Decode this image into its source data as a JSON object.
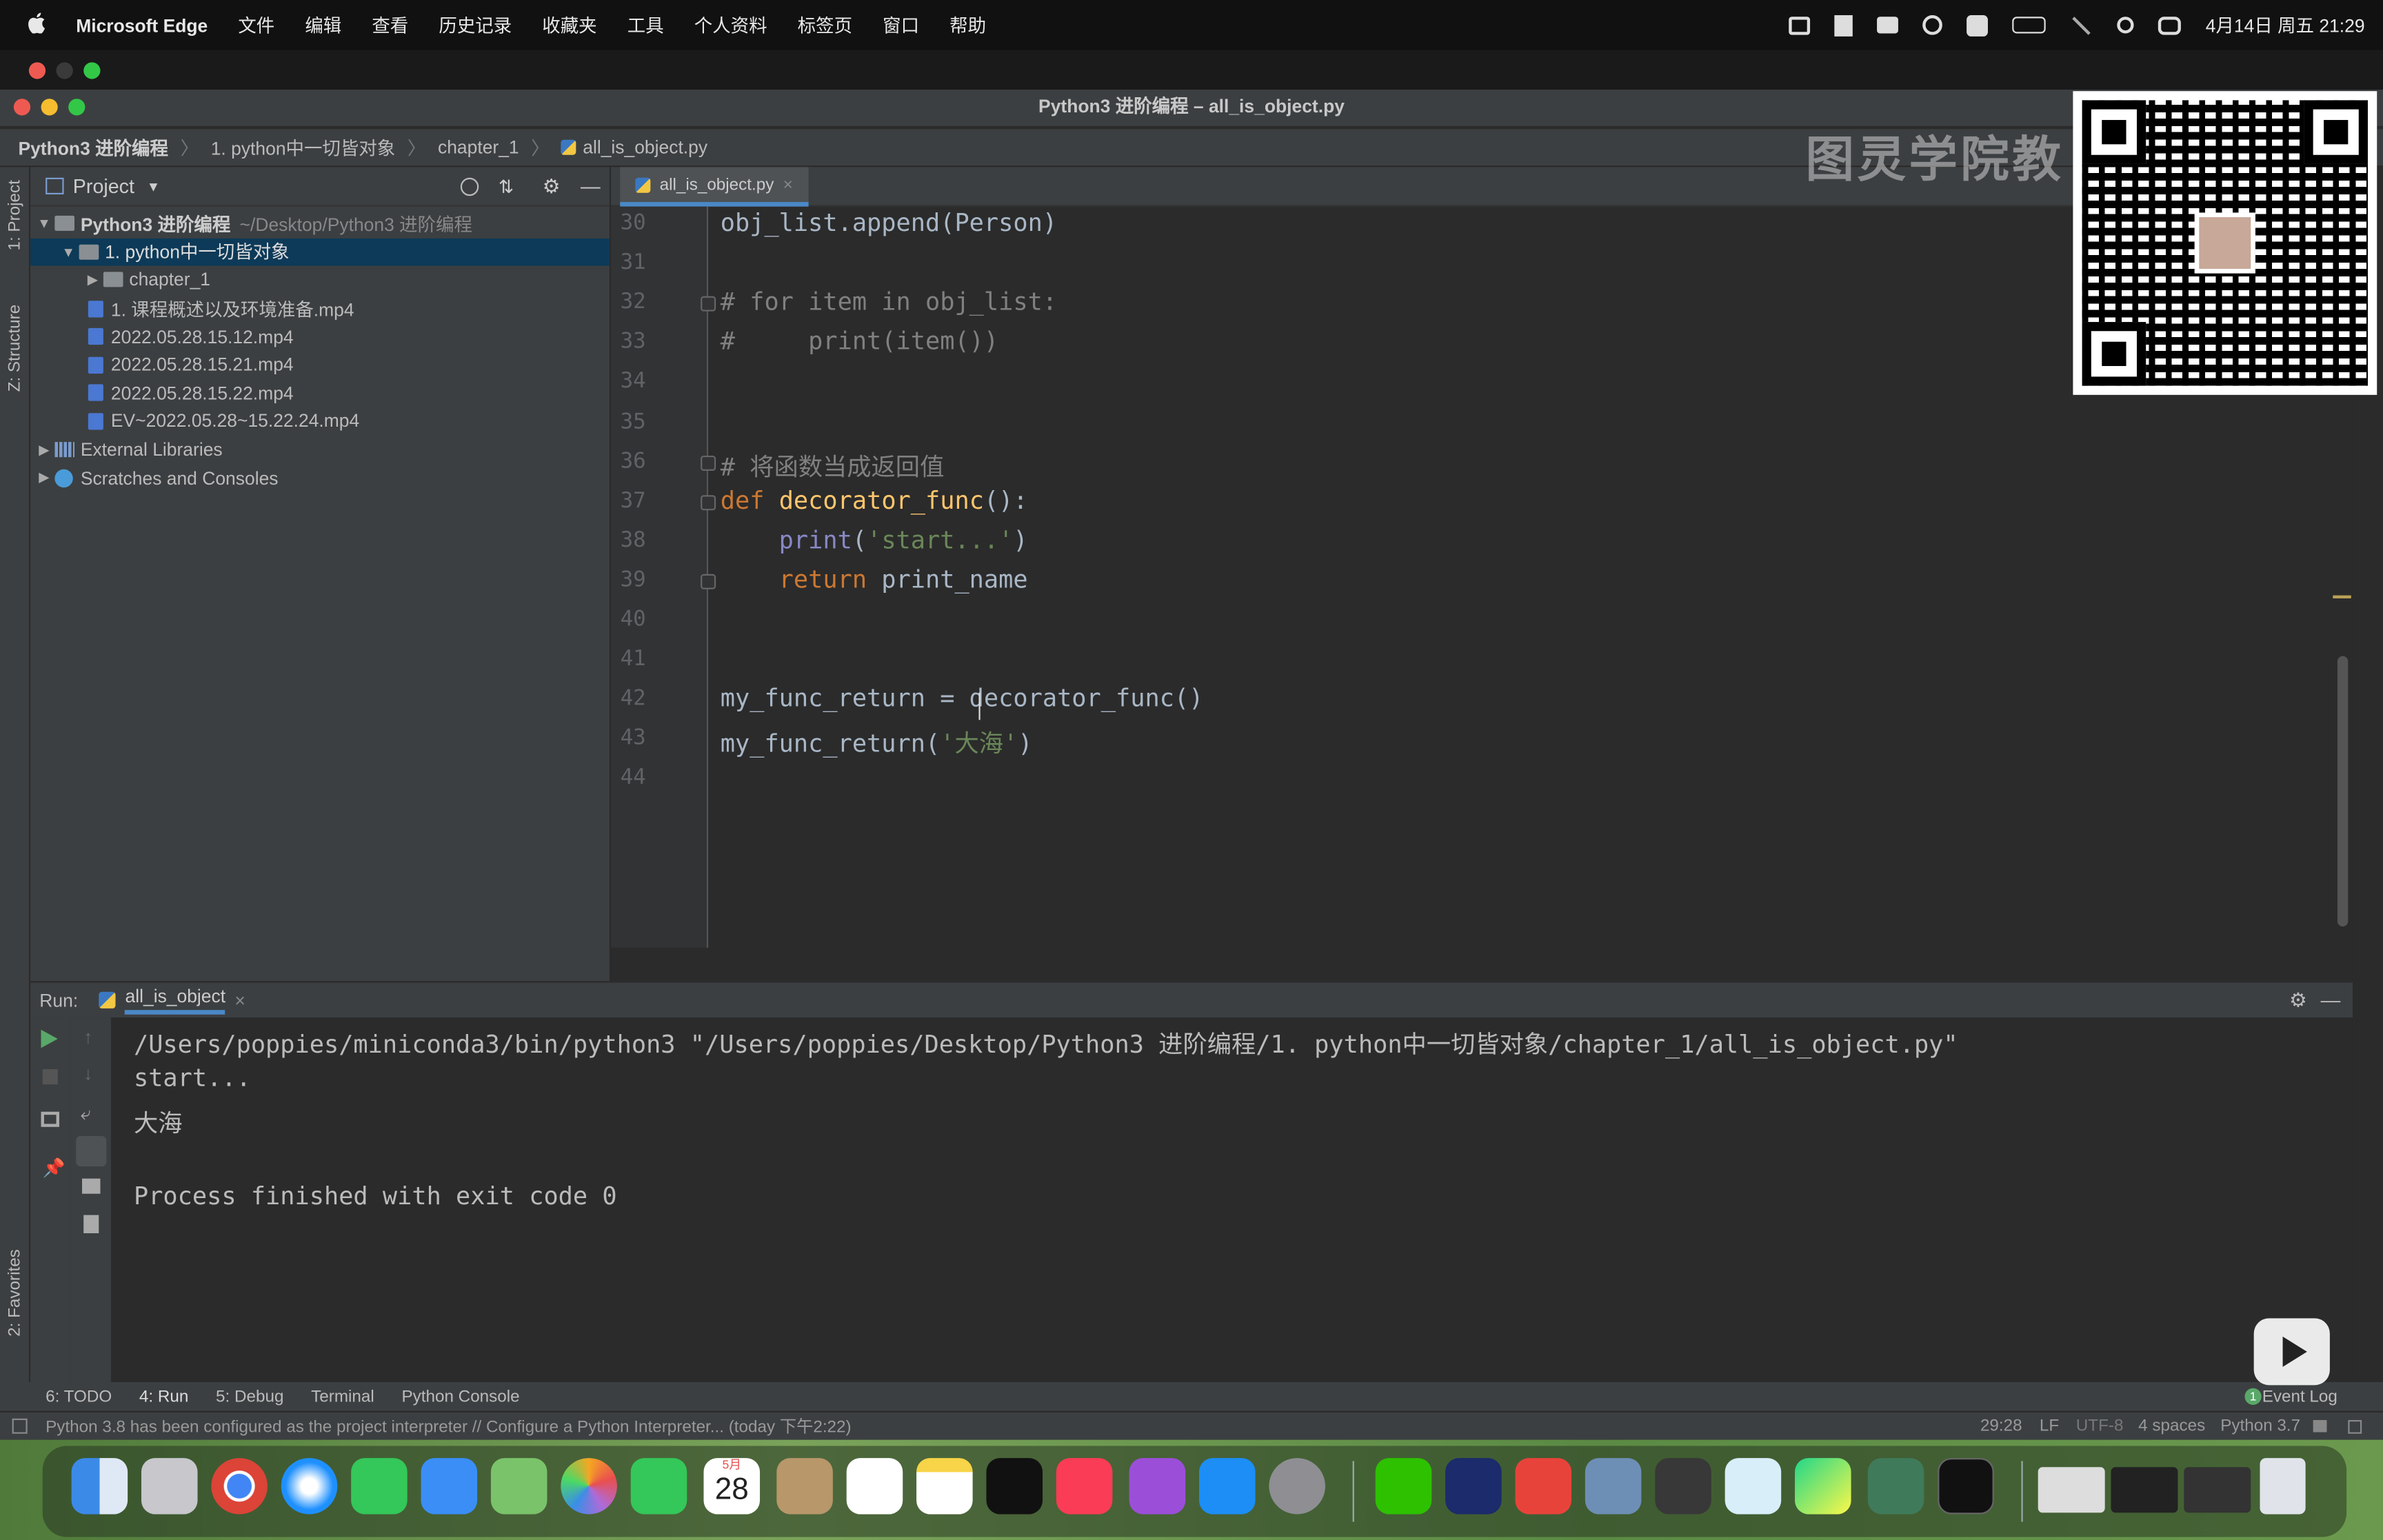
{
  "menubar": {
    "apple": "",
    "app_name": "Microsoft Edge",
    "items": [
      "文件",
      "编辑",
      "查看",
      "历史记录",
      "收藏夹",
      "工具",
      "个人资料",
      "标签页",
      "窗口",
      "帮助"
    ],
    "clock": "4月14日 周五  21:29"
  },
  "window": {
    "title": "Python3 进阶编程 – all_is_object.py"
  },
  "breadcrumb": [
    "Python3 进阶编程",
    "1. python中一切皆对象",
    "chapter_1",
    "all_is_object.py"
  ],
  "watermark": "图灵学院教",
  "left_strip": {
    "project": "1: Project",
    "structure": "Z: Structure",
    "favorites": "2: Favorites"
  },
  "project": {
    "header": "Project",
    "tree": [
      {
        "label": "Python3 进阶编程",
        "suffix": "~/Desktop/Python3 进阶编程",
        "type": "folder",
        "expanded": true
      },
      {
        "label": "1. python中一切皆对象",
        "type": "folder",
        "expanded": true,
        "selected": true
      },
      {
        "label": "chapter_1",
        "type": "folder",
        "expanded": false
      },
      {
        "label": "1. 课程概述以及环境准备.mp4",
        "type": "mp4"
      },
      {
        "label": "2022.05.28.15.12.mp4",
        "type": "mp4"
      },
      {
        "label": "2022.05.28.15.21.mp4",
        "type": "mp4"
      },
      {
        "label": "2022.05.28.15.22.mp4",
        "type": "mp4"
      },
      {
        "label": "EV~2022.05.28~15.22.24.mp4",
        "type": "mp4"
      },
      {
        "label": "External Libraries",
        "type": "lib"
      },
      {
        "label": "Scratches and Consoles",
        "type": "scratch"
      }
    ]
  },
  "editor": {
    "tab": "all_is_object.py",
    "line_numbers": [
      "30",
      "31",
      "32",
      "33",
      "34",
      "35",
      "36",
      "37",
      "38",
      "39",
      "40",
      "41",
      "42",
      "43",
      "44"
    ],
    "lines": [
      "obj_list.append(Person)",
      "",
      "# for item in obj_list:",
      "#     print(item())",
      "",
      "",
      "# 将函数当成返回值",
      "def decorator_func():",
      "    print('start...')",
      "    return print_name",
      "",
      "",
      "my_func_return = decorator_func()",
      "my_func_return('大海')",
      ""
    ]
  },
  "run": {
    "label": "Run:",
    "tab": "all_is_object",
    "output": [
      "/Users/poppies/miniconda3/bin/python3 \"/Users/poppies/Desktop/Python3 进阶编程/1. python中一切皆对象/chapter_1/all_is_object.py\"",
      "start...",
      "大海",
      "",
      "Process finished with exit code 0"
    ]
  },
  "toolwindows": [
    "6: TODO",
    "4: Run",
    "5: Debug",
    "Terminal",
    "Python Console"
  ],
  "event_log": "Event Log",
  "event_count": "1",
  "status": {
    "message": "Python 3.8 has been configured as the project interpreter // Configure a Python Interpreter... (today 下午2:22)",
    "position": "29:28",
    "line_sep": "LF",
    "encoding": "UTF-8",
    "indent": "4 spaces",
    "interpreter": "Python 3.7"
  },
  "dock": {
    "calendar_month": "5月",
    "calendar_day": "28"
  }
}
